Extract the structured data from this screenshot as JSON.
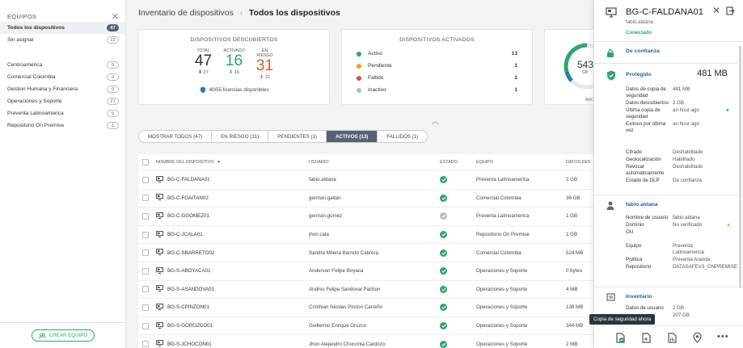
{
  "sidebar": {
    "title": "EQUIPOS",
    "items_top": [
      {
        "label": "Todos los dispositivos",
        "count": "47"
      },
      {
        "label": "Sin asignar",
        "count": "12"
      }
    ],
    "items": [
      {
        "label": "Centroamerica",
        "count": "0"
      },
      {
        "label": "Comercial Colombia",
        "count": "2"
      },
      {
        "label": "Gestion Humana y Financiera",
        "count": "0"
      },
      {
        "label": "Operaciones y Soporte",
        "count": "27"
      },
      {
        "label": "Preventa Latinoamerica",
        "count": "5"
      },
      {
        "label": "Repositorio On Premise",
        "count": "1"
      }
    ],
    "create_label": "CREAR EQUIPO"
  },
  "breadcrumb": {
    "parent": "Inventario de dispositivos",
    "current": "Todos los dispositivos"
  },
  "discovered": {
    "title": "DISPOSITIVOS DESCUBIERTOS",
    "total_label": "TOTAL",
    "total": "47",
    "total_sub": "27",
    "active_label": "ACTIVADO",
    "active": "16",
    "active_sub": "15",
    "risk_label": "EN RIESGO",
    "risk": "31",
    "risk_sub": "12",
    "licenses": "40/55 licencias disponibles"
  },
  "activated": {
    "title": "DISPOSITIVOS ACTIVADOS",
    "rows": [
      {
        "label": "Activo",
        "count": "13",
        "color": "#2fa56a"
      },
      {
        "label": "Pendiente",
        "count": "1",
        "color": "#f0a020"
      },
      {
        "label": "Fallido",
        "count": "1",
        "color": "#e0503a"
      },
      {
        "label": "Inactivo",
        "count": "1",
        "color": "#b7bbc2"
      }
    ]
  },
  "storage": {
    "value": "543",
    "unit": "GB",
    "label": "ARC"
  },
  "tabs": [
    {
      "label": "MOSTRAR TODOS (47)"
    },
    {
      "label": "EN RIESGO (31)"
    },
    {
      "label": "PENDIENTES (1)"
    },
    {
      "label": "ACTIVOS (13)"
    },
    {
      "label": "FALLIDOS (1)"
    }
  ],
  "table": {
    "headers": {
      "name": "NOMBRE DEL DISPOSITIVO",
      "user": "USUARIO",
      "state": "ESTADO",
      "team": "EQUIPO",
      "data": "DATOS DES"
    },
    "rows": [
      {
        "name": "BG-C-FALDANA01",
        "user": "fabio.aldana",
        "team": "Preventa Latinoamerica",
        "data": "2 GB",
        "state": "ok"
      },
      {
        "name": "BG-C-FGAITAN02",
        "user": "german.gaitan",
        "team": "Comercial Colombia",
        "data": "36 GB",
        "state": "ok"
      },
      {
        "name": "BG-C-GGOMEZ01",
        "user": "german.gomez",
        "team": "Preventa Latinoamerica",
        "data": "1 GB",
        "state": "grey"
      },
      {
        "name": "BG-C-JCALA01",
        "user": "jhon.cala",
        "team": "Repositorio On Premise",
        "data": "1 GB",
        "state": "ok"
      },
      {
        "name": "BG-C-SBARRETO02",
        "user": "Sandra Milena Barreto Cabrera",
        "team": "Comercial Colombia",
        "data": "524 MB",
        "state": "ok"
      },
      {
        "name": "BG-S-ABOYACA01",
        "user": "Anderson Felipe Boyaca",
        "team": "Operaciones y Soporte",
        "data": "0 bytes",
        "state": "ok"
      },
      {
        "name": "BG-S-ASANDOVA01",
        "user": "Andres Felipe Sandoval Pachon",
        "team": "Operaciones y Soporte",
        "data": "4 MB",
        "state": "ok"
      },
      {
        "name": "BG-S-CPINZON01",
        "user": "Cristhian Nicolas Pinzon Carreño",
        "team": "Operaciones y Soporte",
        "data": "136 MB",
        "state": "ok"
      },
      {
        "name": "BG-S-GOROZCO01",
        "user": "Guillermo Enrique Orozco",
        "team": "Operaciones y Soporte",
        "data": "344 MB",
        "state": "ok"
      },
      {
        "name": "BG-S-JCHOCON01",
        "user": "Jhon Alejandro Choconta Cardozo",
        "team": "Operaciones y Soporte",
        "data": "2 MB",
        "state": "ok"
      }
    ]
  },
  "panel": {
    "device": "BG-C-FALDANA01",
    "user": "fabio.aldana",
    "status": "Conectado",
    "trust": "De confianza",
    "protected_label": "Protegido",
    "protected_size": "481 MB",
    "backup": [
      {
        "k": "Datos de copia de seguridad",
        "v": "481 MB"
      },
      {
        "k": "Datos descubiertos",
        "v": "2 GB"
      },
      {
        "k": "Última copia de seguridad",
        "v": "an hour ago"
      },
      {
        "k": "Exitoso por última vez",
        "v": "an hour ago"
      }
    ],
    "security": [
      {
        "k": "Cifrado",
        "v": "Deshabilitado"
      },
      {
        "k": "Geolocalización",
        "v": "Habilitado"
      },
      {
        "k": "Revocar automáticamente",
        "v": "Deshabilitado"
      },
      {
        "k": "Estado de DLP",
        "v": "De confianza"
      }
    ],
    "user_section": "fabio.aldana",
    "user_rows": [
      {
        "k": "Nombre de usuario",
        "v": "fabio.aldana"
      },
      {
        "k": "Dominio",
        "v": "No verificado"
      },
      {
        "k": "OU",
        "v": ""
      },
      {
        "k": "Equipo",
        "v": "Preventa Latinoamerica"
      },
      {
        "k": "Política",
        "v": "Preventa Aranda"
      },
      {
        "k": "Repositorio",
        "v": "DATASAFEV3_ONPREMISE"
      }
    ],
    "inventory": "Inventario",
    "inv_rows": [
      {
        "k": "Datos de usuario",
        "v": "2 GB"
      },
      {
        "k": "",
        "v": "207 GB"
      }
    ],
    "tooltip": "Copia de seguridad ahora"
  }
}
